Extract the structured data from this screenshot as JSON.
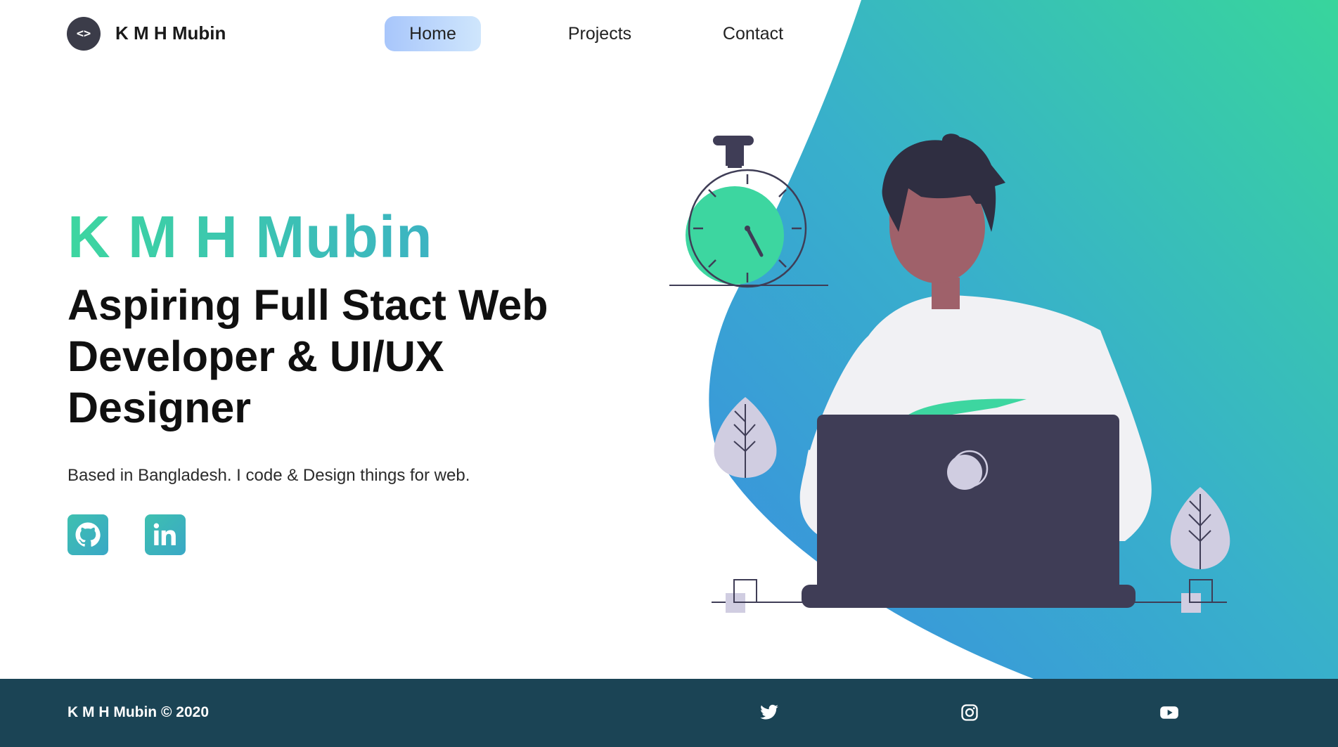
{
  "brand": {
    "logo_glyph": "<>",
    "name": "K M H Mubin"
  },
  "nav": {
    "items": [
      {
        "label": "Home",
        "active": true
      },
      {
        "label": "Projects"
      },
      {
        "label": "Contact"
      }
    ]
  },
  "hero": {
    "name": "K M H Mubin",
    "title": "Aspiring Full Stact Web Developer & UI/UX Designer",
    "subtitle": "Based in Bangladesh. I code & Design things for web."
  },
  "social": [
    {
      "icon": "github-icon"
    },
    {
      "icon": "linkedin-icon"
    }
  ],
  "footer": {
    "copyright": "K M H Mubin © 2020",
    "icons": [
      "twitter-icon",
      "instagram-icon",
      "youtube-icon"
    ]
  },
  "colors": {
    "gradient_green": "#3dd6a0",
    "gradient_blue": "#3b9fd6",
    "footer_bg": "#1b4455",
    "laptop": "#3f3d56",
    "nav_active_start": "#a8c6fb",
    "nav_active_end": "#cfe6fc"
  }
}
